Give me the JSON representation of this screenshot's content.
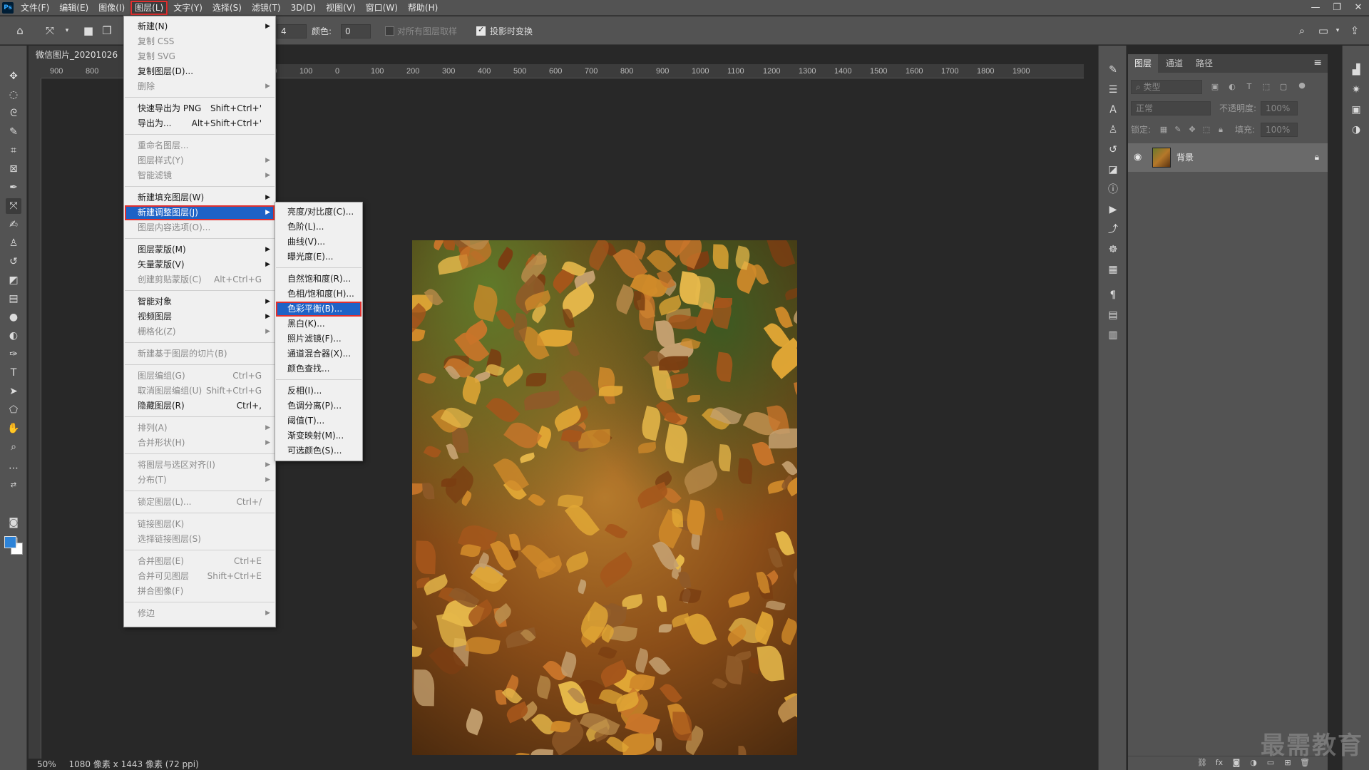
{
  "menubar": {
    "logo": "Ps",
    "items": [
      "文件(F)",
      "编辑(E)",
      "图像(I)",
      "图层(L)",
      "文字(Y)",
      "选择(S)",
      "滤镜(T)",
      "3D(D)",
      "视图(V)",
      "窗口(W)",
      "帮助(H)"
    ],
    "active_index": 3,
    "window_controls": [
      "—",
      "❐",
      "✕"
    ]
  },
  "options": {
    "size_value": "4",
    "color_label": "颜色:",
    "color_value": "0",
    "sample_all_label": "对所有图层取样",
    "transform_label": "投影时变换",
    "transform_checked": true
  },
  "document": {
    "tab_title": "微信图片_20201026",
    "ruler_ticks": [
      "900",
      "800",
      "",
      "",
      "",
      "",
      "200",
      "100",
      "0",
      "100",
      "200",
      "300",
      "400",
      "500",
      "600",
      "700",
      "800",
      "900",
      "1000",
      "1100",
      "1200",
      "1300",
      "1400",
      "1500",
      "1600",
      "1700",
      "1800",
      "1900"
    ],
    "status_zoom": "50%",
    "status_info": "1080 像素 x 1443 像素 (72 ppi)"
  },
  "layer_menu": {
    "items": [
      {
        "label": "新建(N)",
        "shortcut": "",
        "submenu": true,
        "dim": false
      },
      {
        "label": "复制 CSS",
        "shortcut": "",
        "submenu": false,
        "dim": true
      },
      {
        "label": "复制 SVG",
        "shortcut": "",
        "submenu": false,
        "dim": true
      },
      {
        "label": "复制图层(D)...",
        "shortcut": "",
        "submenu": false,
        "dim": false
      },
      {
        "label": "删除",
        "shortcut": "",
        "submenu": true,
        "dim": true
      },
      {
        "label": "快速导出为 PNG",
        "shortcut": "Shift+Ctrl+'",
        "submenu": false,
        "dim": false
      },
      {
        "label": "导出为...",
        "shortcut": "Alt+Shift+Ctrl+'",
        "submenu": false,
        "dim": false
      },
      {
        "label": "重命名图层...",
        "shortcut": "",
        "submenu": false,
        "dim": true
      },
      {
        "label": "图层样式(Y)",
        "shortcut": "",
        "submenu": true,
        "dim": true
      },
      {
        "label": "智能滤镜",
        "shortcut": "",
        "submenu": true,
        "dim": true
      },
      {
        "label": "新建填充图层(W)",
        "shortcut": "",
        "submenu": true,
        "dim": false
      },
      {
        "label": "新建调整图层(J)",
        "shortcut": "",
        "submenu": true,
        "dim": false,
        "highlight": true
      },
      {
        "label": "图层内容选项(O)...",
        "shortcut": "",
        "submenu": false,
        "dim": true
      },
      {
        "label": "图层蒙版(M)",
        "shortcut": "",
        "submenu": true,
        "dim": false
      },
      {
        "label": "矢量蒙版(V)",
        "shortcut": "",
        "submenu": true,
        "dim": false
      },
      {
        "label": "创建剪贴蒙版(C)",
        "shortcut": "Alt+Ctrl+G",
        "submenu": false,
        "dim": true
      },
      {
        "label": "智能对象",
        "shortcut": "",
        "submenu": true,
        "dim": false
      },
      {
        "label": "视频图层",
        "shortcut": "",
        "submenu": true,
        "dim": false
      },
      {
        "label": "栅格化(Z)",
        "shortcut": "",
        "submenu": true,
        "dim": true
      },
      {
        "label": "新建基于图层的切片(B)",
        "shortcut": "",
        "submenu": false,
        "dim": true
      },
      {
        "label": "图层编组(G)",
        "shortcut": "Ctrl+G",
        "submenu": false,
        "dim": true
      },
      {
        "label": "取消图层编组(U)",
        "shortcut": "Shift+Ctrl+G",
        "submenu": false,
        "dim": true
      },
      {
        "label": "隐藏图层(R)",
        "shortcut": "Ctrl+,",
        "submenu": false,
        "dim": false
      },
      {
        "label": "排列(A)",
        "shortcut": "",
        "submenu": true,
        "dim": true
      },
      {
        "label": "合并形状(H)",
        "shortcut": "",
        "submenu": true,
        "dim": true
      },
      {
        "label": "将图层与选区对齐(I)",
        "shortcut": "",
        "submenu": true,
        "dim": true
      },
      {
        "label": "分布(T)",
        "shortcut": "",
        "submenu": true,
        "dim": true
      },
      {
        "label": "锁定图层(L)...",
        "shortcut": "Ctrl+/",
        "submenu": false,
        "dim": true
      },
      {
        "label": "链接图层(K)",
        "shortcut": "",
        "submenu": false,
        "dim": true
      },
      {
        "label": "选择链接图层(S)",
        "shortcut": "",
        "submenu": false,
        "dim": true
      },
      {
        "label": "合并图层(E)",
        "shortcut": "Ctrl+E",
        "submenu": false,
        "dim": true
      },
      {
        "label": "合并可见图层",
        "shortcut": "Shift+Ctrl+E",
        "submenu": false,
        "dim": true
      },
      {
        "label": "拼合图像(F)",
        "shortcut": "",
        "submenu": false,
        "dim": true
      },
      {
        "label": "修边",
        "shortcut": "",
        "submenu": true,
        "dim": true
      }
    ]
  },
  "adjustment_submenu": {
    "items": [
      "亮度/对比度(C)...",
      "色阶(L)...",
      "曲线(V)...",
      "曝光度(E)...",
      "自然饱和度(R)...",
      "色相/饱和度(H)...",
      "色彩平衡(B)...",
      "黑白(K)...",
      "照片滤镜(F)...",
      "通道混合器(X)...",
      "颜色查找...",
      "反相(I)...",
      "色调分离(P)...",
      "阈值(T)...",
      "渐变映射(M)...",
      "可选颜色(S)..."
    ],
    "highlight_index": 6
  },
  "layers_panel": {
    "tabs": [
      "图层",
      "通道",
      "路径"
    ],
    "active_tab": 0,
    "filter_placeholder": "类型",
    "blend_mode": "正常",
    "opacity_label": "不透明度:",
    "opacity_value": "100%",
    "lock_label": "锁定:",
    "fill_label": "填充:",
    "fill_value": "100%",
    "layers": [
      {
        "name": "背景",
        "locked": true,
        "visible": true
      }
    ]
  },
  "watermark": "最需教育"
}
